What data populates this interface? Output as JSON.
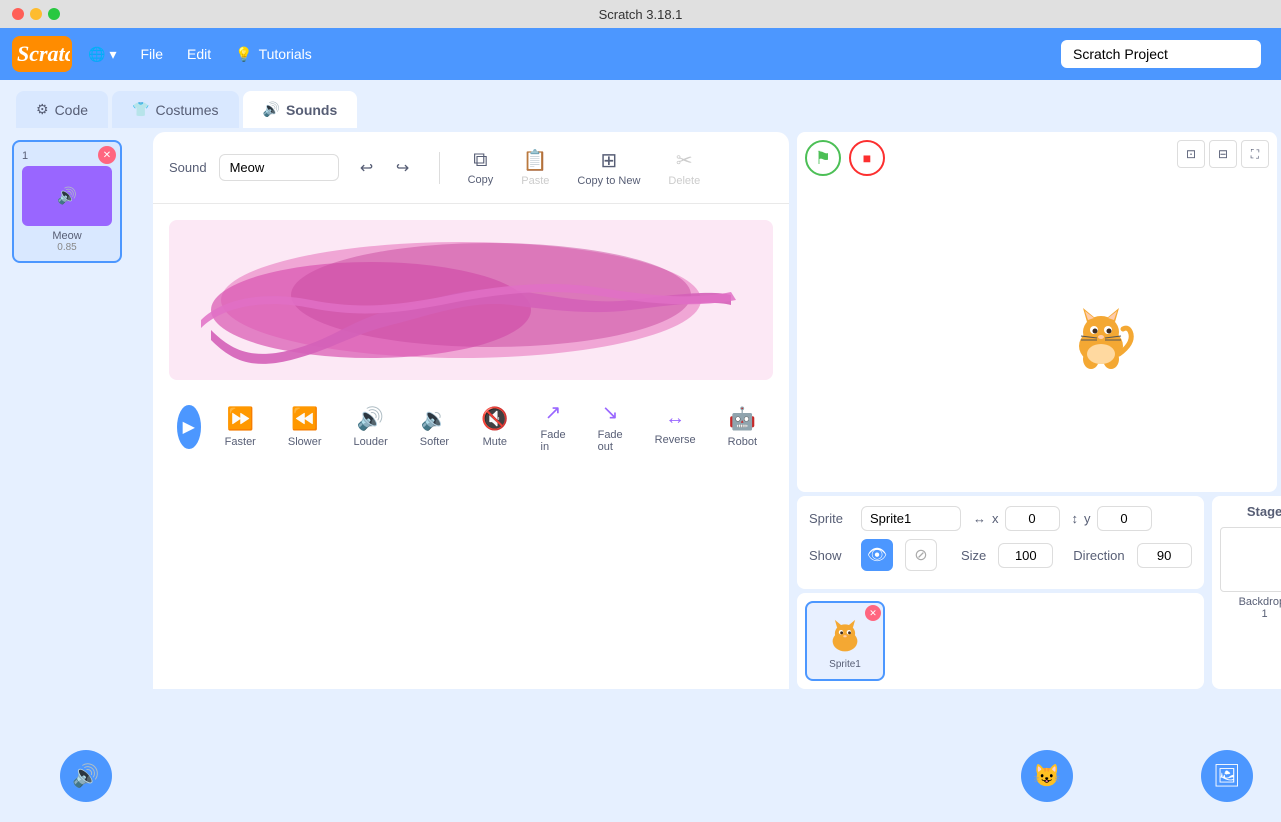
{
  "titlebar": {
    "title": "Scratch 3.18.1"
  },
  "menubar": {
    "logo": "Scratch",
    "globe_label": "🌐",
    "globe_arrow": "▾",
    "file_label": "File",
    "edit_label": "Edit",
    "tutorials_icon": "💡",
    "tutorials_label": "Tutorials",
    "project_name": "Scratch Project"
  },
  "tabs": {
    "code_label": "Code",
    "costumes_label": "Costumes",
    "sounds_label": "Sounds"
  },
  "sound_list": {
    "sounds": [
      {
        "num": "1",
        "name": "Meow",
        "duration": "0.85"
      }
    ]
  },
  "sound_editor": {
    "sound_label": "Sound",
    "sound_name": "Meow",
    "copy_label": "Copy",
    "paste_label": "Paste",
    "copy_to_new_label": "Copy to New",
    "delete_label": "Delete"
  },
  "playback": {
    "play_icon": "▶",
    "effects": [
      {
        "icon": "⏩",
        "label": "Faster"
      },
      {
        "icon": "⏪",
        "label": "Slower"
      },
      {
        "icon": "🔊",
        "label": "Louder"
      },
      {
        "icon": "🔉",
        "label": "Softer"
      },
      {
        "icon": "🔇",
        "label": "Mute"
      },
      {
        "icon": "↗",
        "label": "Fade in"
      },
      {
        "icon": "↘",
        "label": "Fade out"
      },
      {
        "icon": "↔",
        "label": "Reverse"
      },
      {
        "icon": "🤖",
        "label": "Robot"
      }
    ]
  },
  "stage_controls": {
    "green_flag": "⚑",
    "stop": "■"
  },
  "sprite_info": {
    "sprite_label": "Sprite",
    "sprite_name": "Sprite1",
    "x_icon": "↔",
    "x_label": "x",
    "x_value": "0",
    "y_icon": "↕",
    "y_label": "y",
    "y_value": "0",
    "show_label": "Show",
    "size_label": "Size",
    "size_value": "100",
    "direction_label": "Direction",
    "direction_value": "90"
  },
  "sprite_list": {
    "sprites": [
      {
        "name": "Sprite1"
      }
    ]
  },
  "stage_panel": {
    "title": "Stage",
    "backdrop_label": "Backdrops",
    "backdrop_count": "1"
  },
  "bottom_buttons": {
    "add_sound_icon": "🔊",
    "add_sprite_icon": "😺",
    "add_stage_icon": "🖼"
  }
}
